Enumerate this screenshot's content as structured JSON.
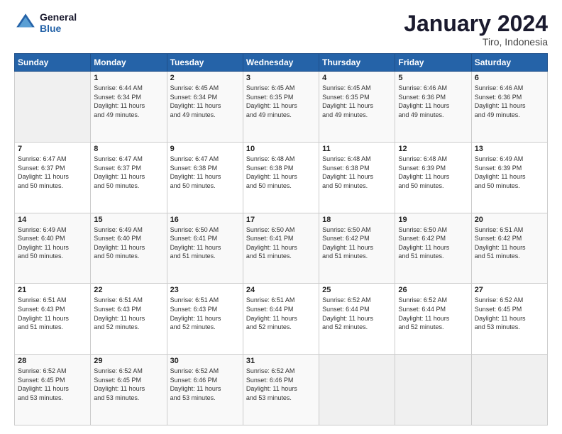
{
  "logo": {
    "line1": "General",
    "line2": "Blue"
  },
  "title": "January 2024",
  "subtitle": "Tiro, Indonesia",
  "days_header": [
    "Sunday",
    "Monday",
    "Tuesday",
    "Wednesday",
    "Thursday",
    "Friday",
    "Saturday"
  ],
  "weeks": [
    [
      {
        "num": "",
        "info": ""
      },
      {
        "num": "1",
        "info": "Sunrise: 6:44 AM\nSunset: 6:34 PM\nDaylight: 11 hours\nand 49 minutes."
      },
      {
        "num": "2",
        "info": "Sunrise: 6:45 AM\nSunset: 6:34 PM\nDaylight: 11 hours\nand 49 minutes."
      },
      {
        "num": "3",
        "info": "Sunrise: 6:45 AM\nSunset: 6:35 PM\nDaylight: 11 hours\nand 49 minutes."
      },
      {
        "num": "4",
        "info": "Sunrise: 6:45 AM\nSunset: 6:35 PM\nDaylight: 11 hours\nand 49 minutes."
      },
      {
        "num": "5",
        "info": "Sunrise: 6:46 AM\nSunset: 6:36 PM\nDaylight: 11 hours\nand 49 minutes."
      },
      {
        "num": "6",
        "info": "Sunrise: 6:46 AM\nSunset: 6:36 PM\nDaylight: 11 hours\nand 49 minutes."
      }
    ],
    [
      {
        "num": "7",
        "info": "Sunrise: 6:47 AM\nSunset: 6:37 PM\nDaylight: 11 hours\nand 50 minutes."
      },
      {
        "num": "8",
        "info": "Sunrise: 6:47 AM\nSunset: 6:37 PM\nDaylight: 11 hours\nand 50 minutes."
      },
      {
        "num": "9",
        "info": "Sunrise: 6:47 AM\nSunset: 6:38 PM\nDaylight: 11 hours\nand 50 minutes."
      },
      {
        "num": "10",
        "info": "Sunrise: 6:48 AM\nSunset: 6:38 PM\nDaylight: 11 hours\nand 50 minutes."
      },
      {
        "num": "11",
        "info": "Sunrise: 6:48 AM\nSunset: 6:38 PM\nDaylight: 11 hours\nand 50 minutes."
      },
      {
        "num": "12",
        "info": "Sunrise: 6:48 AM\nSunset: 6:39 PM\nDaylight: 11 hours\nand 50 minutes."
      },
      {
        "num": "13",
        "info": "Sunrise: 6:49 AM\nSunset: 6:39 PM\nDaylight: 11 hours\nand 50 minutes."
      }
    ],
    [
      {
        "num": "14",
        "info": "Sunrise: 6:49 AM\nSunset: 6:40 PM\nDaylight: 11 hours\nand 50 minutes."
      },
      {
        "num": "15",
        "info": "Sunrise: 6:49 AM\nSunset: 6:40 PM\nDaylight: 11 hours\nand 50 minutes."
      },
      {
        "num": "16",
        "info": "Sunrise: 6:50 AM\nSunset: 6:41 PM\nDaylight: 11 hours\nand 51 minutes."
      },
      {
        "num": "17",
        "info": "Sunrise: 6:50 AM\nSunset: 6:41 PM\nDaylight: 11 hours\nand 51 minutes."
      },
      {
        "num": "18",
        "info": "Sunrise: 6:50 AM\nSunset: 6:42 PM\nDaylight: 11 hours\nand 51 minutes."
      },
      {
        "num": "19",
        "info": "Sunrise: 6:50 AM\nSunset: 6:42 PM\nDaylight: 11 hours\nand 51 minutes."
      },
      {
        "num": "20",
        "info": "Sunrise: 6:51 AM\nSunset: 6:42 PM\nDaylight: 11 hours\nand 51 minutes."
      }
    ],
    [
      {
        "num": "21",
        "info": "Sunrise: 6:51 AM\nSunset: 6:43 PM\nDaylight: 11 hours\nand 51 minutes."
      },
      {
        "num": "22",
        "info": "Sunrise: 6:51 AM\nSunset: 6:43 PM\nDaylight: 11 hours\nand 52 minutes."
      },
      {
        "num": "23",
        "info": "Sunrise: 6:51 AM\nSunset: 6:43 PM\nDaylight: 11 hours\nand 52 minutes."
      },
      {
        "num": "24",
        "info": "Sunrise: 6:51 AM\nSunset: 6:44 PM\nDaylight: 11 hours\nand 52 minutes."
      },
      {
        "num": "25",
        "info": "Sunrise: 6:52 AM\nSunset: 6:44 PM\nDaylight: 11 hours\nand 52 minutes."
      },
      {
        "num": "26",
        "info": "Sunrise: 6:52 AM\nSunset: 6:44 PM\nDaylight: 11 hours\nand 52 minutes."
      },
      {
        "num": "27",
        "info": "Sunrise: 6:52 AM\nSunset: 6:45 PM\nDaylight: 11 hours\nand 53 minutes."
      }
    ],
    [
      {
        "num": "28",
        "info": "Sunrise: 6:52 AM\nSunset: 6:45 PM\nDaylight: 11 hours\nand 53 minutes."
      },
      {
        "num": "29",
        "info": "Sunrise: 6:52 AM\nSunset: 6:45 PM\nDaylight: 11 hours\nand 53 minutes."
      },
      {
        "num": "30",
        "info": "Sunrise: 6:52 AM\nSunset: 6:46 PM\nDaylight: 11 hours\nand 53 minutes."
      },
      {
        "num": "31",
        "info": "Sunrise: 6:52 AM\nSunset: 6:46 PM\nDaylight: 11 hours\nand 53 minutes."
      },
      {
        "num": "",
        "info": ""
      },
      {
        "num": "",
        "info": ""
      },
      {
        "num": "",
        "info": ""
      }
    ]
  ]
}
